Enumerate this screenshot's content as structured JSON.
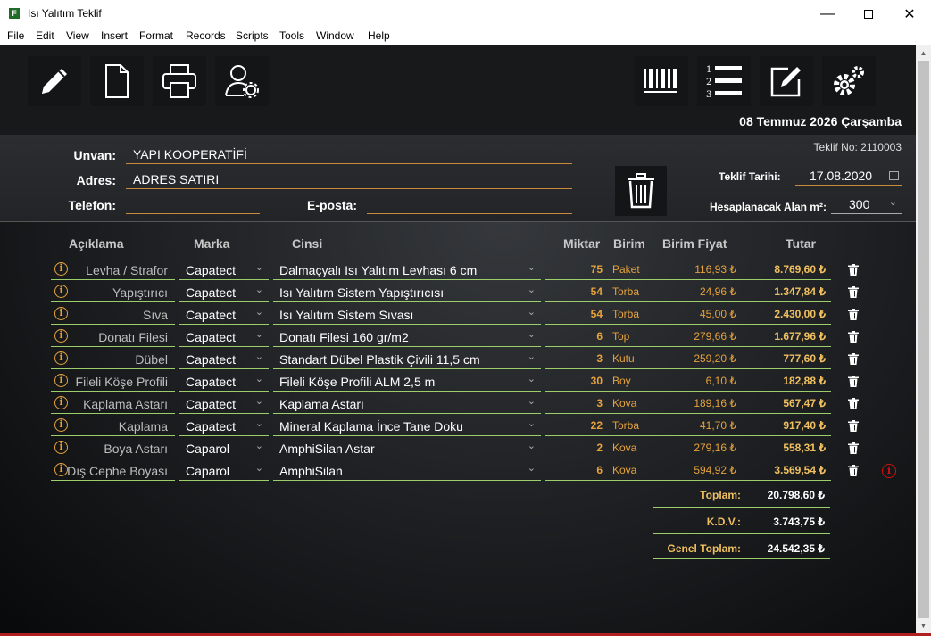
{
  "window": {
    "title": "Isı Yalıtım Teklif",
    "app_icon": "F"
  },
  "menu": [
    "File",
    "Edit",
    "View",
    "Insert",
    "Format",
    "Records",
    "Scripts",
    "Tools",
    "Window",
    "Help"
  ],
  "toolbar": {
    "left_icons": [
      "pencil-icon",
      "new-document-icon",
      "printer-icon",
      "user-settings-icon"
    ],
    "right_icons": [
      "barcode-icon",
      "numbered-list-icon",
      "edit-note-icon",
      "gear-icon"
    ]
  },
  "header": {
    "date_long": "08 Temmuz 2026 Çarşamba",
    "teklif_no": "Teklif No: 2110003"
  },
  "form": {
    "unvan_label": "Unvan:",
    "unvan": "YAPI KOOPERATİFİ",
    "adres_label": "Adres:",
    "adres": "ADRES SATIRI",
    "telefon_label": "Telefon:",
    "telefon": "",
    "eposta_label": "E-posta:",
    "eposta": "",
    "teklif_tarihi_label": "Teklif Tarihi:",
    "teklif_tarihi": "17.08.2020",
    "alan_label": "Hesaplanacak Alan m²:",
    "alan": "300"
  },
  "columns": [
    "Açıklama",
    "Marka",
    "Cinsi",
    "Miktar",
    "Birim",
    "Birim Fiyat",
    "Tutar"
  ],
  "rows": [
    {
      "aciklama": "Levha / Strafor",
      "marka": "Capatect",
      "cinsi": "Dalmaçyalı Isı Yalıtım Levhası 6 cm",
      "miktar": "75",
      "birim": "Paket",
      "birim_fiyat": "116,93 ₺",
      "tutar": "8.769,60 ₺"
    },
    {
      "aciklama": "Yapıştırıcı",
      "marka": "Capatect",
      "cinsi": "Isı Yalıtım Sistem Yapıştırıcısı",
      "miktar": "54",
      "birim": "Torba",
      "birim_fiyat": "24,96 ₺",
      "tutar": "1.347,84 ₺"
    },
    {
      "aciklama": "Sıva",
      "marka": "Capatect",
      "cinsi": "Isı Yalıtım Sistem Sıvası",
      "miktar": "54",
      "birim": "Torba",
      "birim_fiyat": "45,00 ₺",
      "tutar": "2.430,00 ₺"
    },
    {
      "aciklama": "Donatı Filesi",
      "marka": "Capatect",
      "cinsi": "Donatı Filesi 160 gr/m2",
      "miktar": "6",
      "birim": "Top",
      "birim_fiyat": "279,66 ₺",
      "tutar": "1.677,96 ₺"
    },
    {
      "aciklama": "Dübel",
      "marka": "Capatect",
      "cinsi": "Standart Dübel Plastik Çivili 11,5 cm",
      "miktar": "3",
      "birim": "Kutu",
      "birim_fiyat": "259,20 ₺",
      "tutar": "777,60 ₺"
    },
    {
      "aciklama": "Fileli Köşe Profili",
      "marka": "Capatect",
      "cinsi": "Fileli Köşe Profili ALM 2,5 m",
      "miktar": "30",
      "birim": "Boy",
      "birim_fiyat": "6,10 ₺",
      "tutar": "182,88 ₺"
    },
    {
      "aciklama": "Kaplama Astarı",
      "marka": "Capatect",
      "cinsi": "Kaplama Astarı",
      "miktar": "3",
      "birim": "Kova",
      "birim_fiyat": "189,16 ₺",
      "tutar": "567,47 ₺"
    },
    {
      "aciklama": "Kaplama",
      "marka": "Capatect",
      "cinsi": "Mineral Kaplama İnce Tane Doku",
      "miktar": "22",
      "birim": "Torba",
      "birim_fiyat": "41,70 ₺",
      "tutar": "917,40 ₺"
    },
    {
      "aciklama": "Boya Astarı",
      "marka": "Caparol",
      "cinsi": "AmphiSilan Astar",
      "miktar": "2",
      "birim": "Kova",
      "birim_fiyat": "279,16 ₺",
      "tutar": "558,31 ₺"
    },
    {
      "aciklama": "Dış Cephe Boyası",
      "marka": "Caparol",
      "cinsi": "AmphiSilan",
      "miktar": "6",
      "birim": "Kova",
      "birim_fiyat": "594,92 ₺",
      "tutar": "3.569,54 ₺"
    }
  ],
  "totals": {
    "toplam_label": "Toplam:",
    "toplam": "20.798,60 ₺",
    "kdv_label": "K.D.V.:",
    "kdv": "3.743,75 ₺",
    "genel_label": "Genel Toplam:",
    "genel": "24.542,35 ₺"
  },
  "colors": {
    "accent": "#e6a23c",
    "row_line": "#9ccf6a",
    "warning": "#d01010"
  }
}
